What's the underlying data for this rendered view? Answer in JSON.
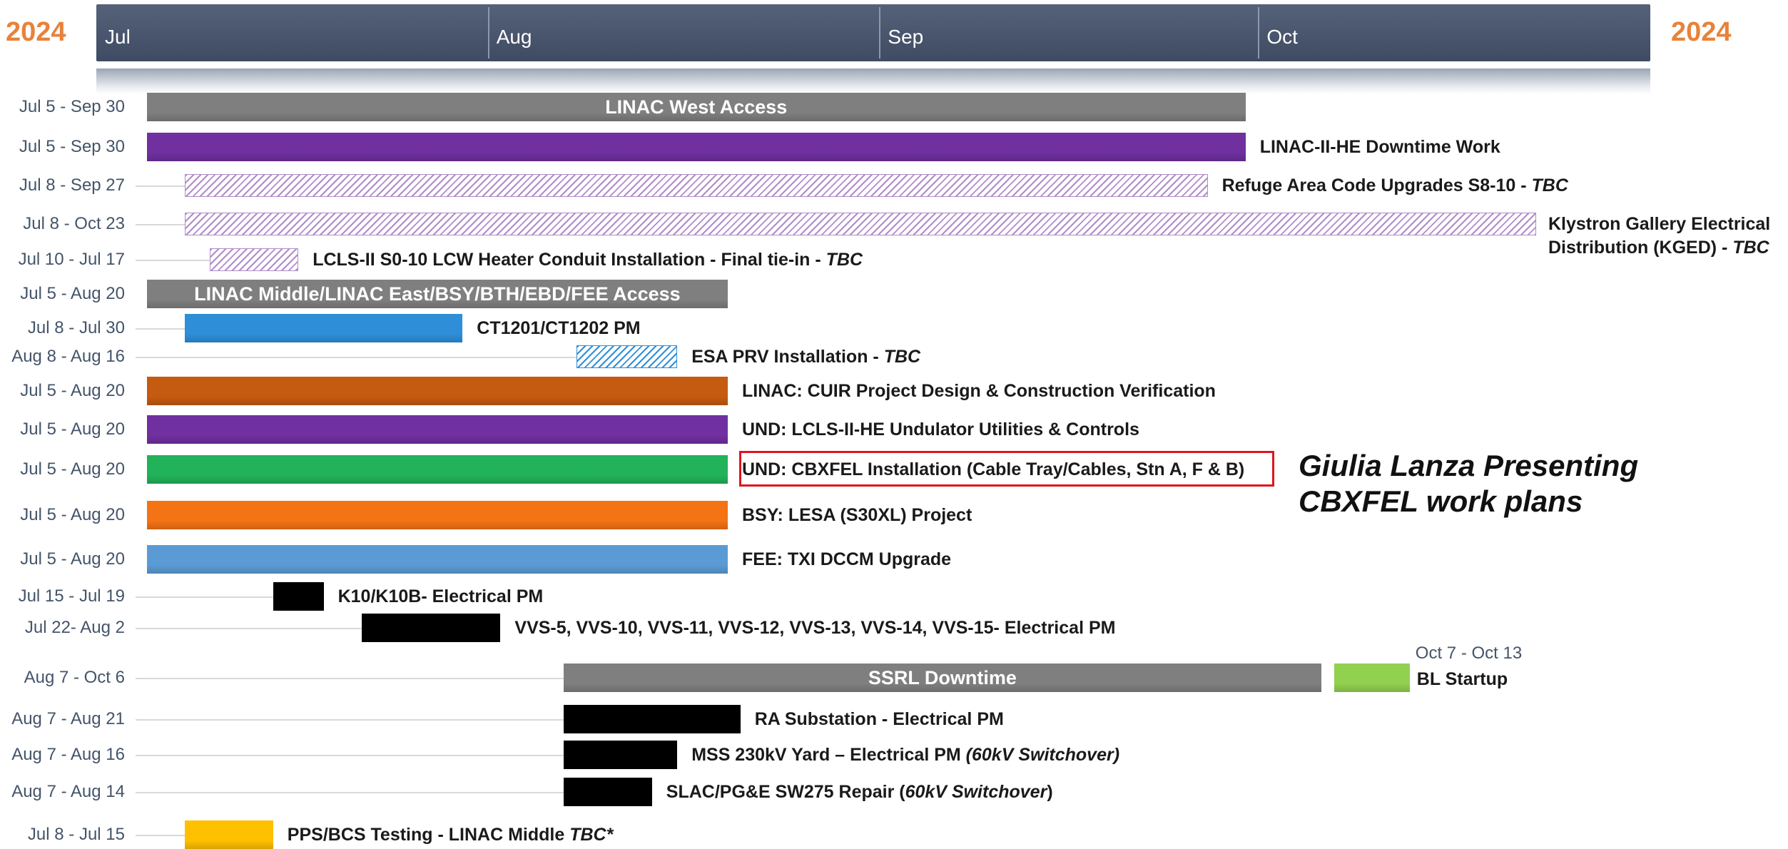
{
  "header": {
    "year_left": "2024",
    "year_right": "2024",
    "months": [
      "Jul",
      "Aug",
      "Sep",
      "Oct"
    ]
  },
  "presenter_note": {
    "line1": "Giulia Lanza Presenting",
    "line2": "CBXFEL work plans"
  },
  "colors": {
    "gray": "#7f7f7f",
    "purple": "#7030a0",
    "blue": "#2e8fd8",
    "orange_brown": "#c55a11",
    "green": "#22b25a",
    "orange": "#f47314",
    "light_blue": "#5b9bd5",
    "black": "#000000",
    "light_green": "#92d050",
    "gold": "#ffc000",
    "highlight": "#e0141e"
  },
  "chart_data": {
    "type": "gantt",
    "x_range": [
      "2024-07-01",
      "2024-10-31"
    ],
    "tasks": [
      {
        "date_label": "Jul 5 - Sep 30",
        "start": "2024-07-05",
        "end": "2024-09-30",
        "label": "LINAC West Access",
        "tbc": "",
        "color": "gray",
        "style": "solid",
        "label_inside": true
      },
      {
        "date_label": "Jul 5 - Sep 30",
        "start": "2024-07-05",
        "end": "2024-09-30",
        "label": "LINAC-II-HE Downtime Work",
        "tbc": "",
        "color": "purple",
        "style": "solid",
        "label_inside": false
      },
      {
        "date_label": "Jul 8 - Sep 27",
        "start": "2024-07-08",
        "end": "2024-09-27",
        "label": "Refuge Area Code Upgrades S8-10 - ",
        "tbc": "TBC",
        "color": "purple",
        "style": "hatch",
        "label_inside": false
      },
      {
        "date_label": "Jul 8 - Oct 23",
        "start": "2024-07-08",
        "end": "2024-10-23",
        "label": "Klystron Gallery Electrical",
        "label2": "Distribution  (KGED) - ",
        "tbc": "TBC",
        "color": "purple",
        "style": "hatch",
        "label_inside": false
      },
      {
        "date_label": "Jul 10 - Jul 17",
        "start": "2024-07-10",
        "end": "2024-07-17",
        "label": "LCLS-II S0-10 LCW Heater Conduit Installation  - Final tie-in - ",
        "tbc": "TBC",
        "color": "purple",
        "style": "hatch",
        "label_inside": false
      },
      {
        "date_label": "Jul 5 - Aug 20",
        "start": "2024-07-05",
        "end": "2024-08-20",
        "label": "LINAC Middle/LINAC East/BSY/BTH/EBD/FEE Access",
        "tbc": "",
        "color": "gray",
        "style": "solid",
        "label_inside": true
      },
      {
        "date_label": "Jul 8 - Jul 30",
        "start": "2024-07-08",
        "end": "2024-07-30",
        "label": "CT1201/CT1202 PM",
        "tbc": "",
        "color": "blue",
        "style": "solid",
        "label_inside": false
      },
      {
        "date_label": "Aug 8 - Aug 16",
        "start": "2024-08-08",
        "end": "2024-08-16",
        "label": "ESA PRV Installation - ",
        "tbc": "TBC",
        "color": "blue",
        "style": "hatch",
        "label_inside": false
      },
      {
        "date_label": "Jul 5 - Aug 20",
        "start": "2024-07-05",
        "end": "2024-08-20",
        "label": "LINAC: CUIR Project Design & Construction Verification",
        "tbc": "",
        "color": "orange_brown",
        "style": "solid",
        "label_inside": false
      },
      {
        "date_label": "Jul 5 - Aug 20",
        "start": "2024-07-05",
        "end": "2024-08-20",
        "label": "UND: LCLS-II-HE Undulator Utilities & Controls",
        "tbc": "",
        "color": "purple",
        "style": "solid",
        "label_inside": false
      },
      {
        "date_label": "Jul 5 - Aug 20",
        "start": "2024-07-05",
        "end": "2024-08-20",
        "label": "UND: CBXFEL Installation (Cable Tray/Cables, Stn A, F & B)",
        "tbc": "",
        "color": "green",
        "style": "solid",
        "label_inside": false,
        "highlighted": true
      },
      {
        "date_label": "Jul 5 - Aug 20",
        "start": "2024-07-05",
        "end": "2024-08-20",
        "label": "BSY: LESA (S30XL) Project",
        "tbc": "",
        "color": "orange",
        "style": "solid",
        "label_inside": false
      },
      {
        "date_label": "Jul 5 - Aug 20",
        "start": "2024-07-05",
        "end": "2024-08-20",
        "label": "FEE: TXI DCCM Upgrade",
        "tbc": "",
        "color": "light_blue",
        "style": "solid",
        "label_inside": false
      },
      {
        "date_label": "Jul 15 - Jul 19",
        "start": "2024-07-15",
        "end": "2024-07-19",
        "label": "K10/K10B- Electrical PM",
        "tbc": "",
        "color": "black",
        "style": "solid",
        "label_inside": false
      },
      {
        "date_label": "Jul 22- Aug  2",
        "start": "2024-07-22",
        "end": "2024-08-02",
        "label": "VVS-5, VVS-10, VVS-11, VVS-12, VVS-13, VVS-14, VVS-15- Electrical PM",
        "tbc": "",
        "color": "black",
        "style": "solid",
        "label_inside": false
      },
      {
        "date_label": "Aug 7 - Oct 6",
        "start": "2024-08-07",
        "end": "2024-10-06",
        "label": "SSRL Downtime",
        "tbc": "",
        "color": "gray",
        "style": "solid",
        "label_inside": true,
        "followup": {
          "date_label": "Oct 7 - Oct 13",
          "start": "2024-10-07",
          "end": "2024-10-13",
          "label": "BL Startup",
          "color": "light_green"
        }
      },
      {
        "date_label": "Aug 7 - Aug 21",
        "start": "2024-08-07",
        "end": "2024-08-21",
        "label": "RA Substation - Electrical PM",
        "tbc": "",
        "color": "black",
        "style": "solid",
        "label_inside": false
      },
      {
        "date_label": "Aug 7 - Aug 16",
        "start": "2024-08-07",
        "end": "2024-08-16",
        "label": "MSS 230kV Yard – Electrical PM ",
        "tbc": "(60kV Switchover)",
        "color": "black",
        "style": "solid",
        "label_inside": false
      },
      {
        "date_label": "Aug 7 - Aug 14",
        "start": "2024-08-07",
        "end": "2024-08-14",
        "label": "SLAC/PG&E SW275 Repair (",
        "tbc": "60kV Switchover",
        "label_after": ")",
        "color": "black",
        "style": "solid",
        "label_inside": false
      },
      {
        "date_label": "Jul 8  - Jul 15",
        "start": "2024-07-08",
        "end": "2024-07-15",
        "label": "PPS/BCS Testing - LINAC Middle ",
        "tbc": "TBC*",
        "color": "gold",
        "style": "solid",
        "label_inside": false
      }
    ]
  }
}
